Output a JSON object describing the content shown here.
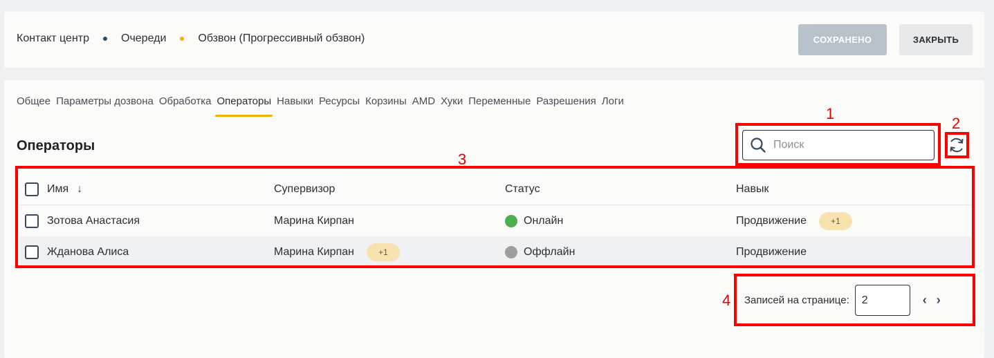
{
  "breadcrumb": {
    "items": [
      "Контакт центр",
      "Очереди",
      "Обзвон (Прогрессивный обзвон)"
    ],
    "dot_colors": [
      "#34495e",
      "#f4b000"
    ]
  },
  "header": {
    "saved_label": "СОХРАНЕНО",
    "close_label": "ЗАКРЫТЬ"
  },
  "tabs": [
    "Общее",
    "Параметры дозвона",
    "Обработка",
    "Операторы",
    "Навыки",
    "Ресурсы",
    "Корзины",
    "AMD",
    "Хуки",
    "Переменные",
    "Разрешения",
    "Логи"
  ],
  "active_tab": "Операторы",
  "section_title": "Операторы",
  "search": {
    "placeholder": "Поиск",
    "icon": "search-icon"
  },
  "refresh": {
    "icon": "refresh-icon"
  },
  "table": {
    "columns": [
      "Имя",
      "Супервизор",
      "Статус",
      "Навык"
    ],
    "sort_icon": "↓",
    "rows": [
      {
        "name": "Зотова Анастасия",
        "supervisor": "Марина Кирпан",
        "supervisor_badge": "",
        "status": "Онлайн",
        "status_color": "#4caf50",
        "skill": "Продвижение",
        "skill_badge": "+1"
      },
      {
        "name": "Жданова Алиса",
        "supervisor": "Марина Кирпан",
        "supervisor_badge": "+1",
        "status": "Оффлайн",
        "status_color": "#9e9e9e",
        "skill": "Продвижение",
        "skill_badge": ""
      }
    ]
  },
  "pagination": {
    "label": "Записей на странице:",
    "per_page": "2",
    "prev": "‹",
    "next": "›"
  },
  "annotations": [
    "1",
    "2",
    "3",
    "4"
  ],
  "colors": {
    "accent": "#f4b000",
    "annotation": "#ff0000"
  }
}
